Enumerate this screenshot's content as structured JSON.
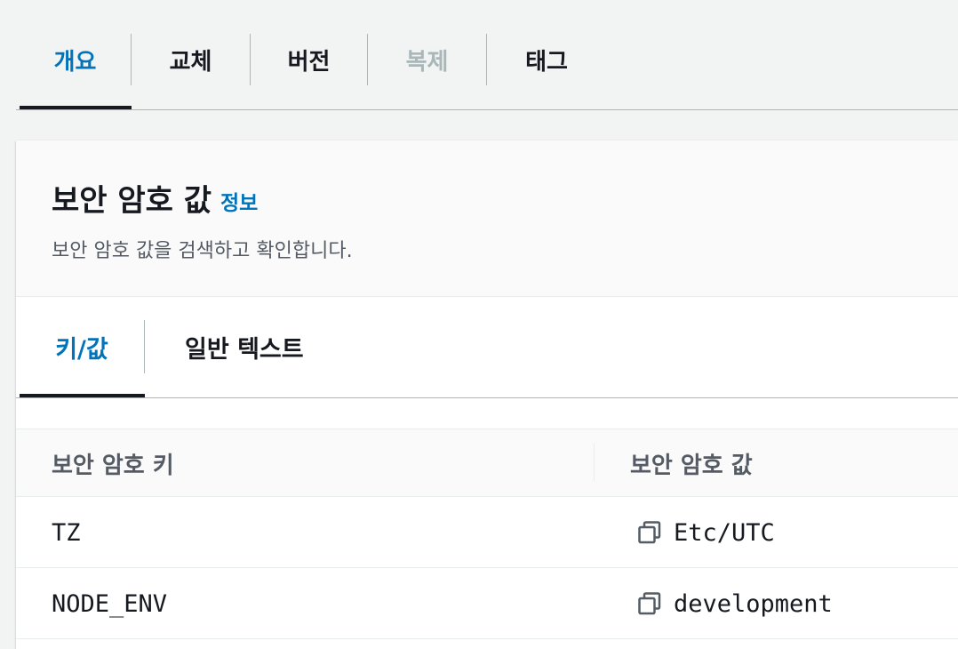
{
  "top_tabs": [
    {
      "label": "개요",
      "state": "active"
    },
    {
      "label": "교체",
      "state": "normal"
    },
    {
      "label": "버전",
      "state": "normal"
    },
    {
      "label": "복제",
      "state": "disabled"
    },
    {
      "label": "태그",
      "state": "normal"
    }
  ],
  "panel": {
    "title": "보안 암호 값",
    "info_link": "정보",
    "description": "보안 암호 값을 검색하고 확인합니다."
  },
  "inner_tabs": [
    {
      "label": "키/값",
      "state": "active"
    },
    {
      "label": "일반 텍스트",
      "state": "normal"
    }
  ],
  "table": {
    "columns": [
      "보안 암호 키",
      "보안 암호 값"
    ],
    "rows": [
      {
        "key": "TZ",
        "value": "Etc/UTC",
        "icon": "copy-icon"
      },
      {
        "key": "NODE_ENV",
        "value": "development",
        "icon": "copy-icon"
      }
    ]
  },
  "colors": {
    "accent": "#0073bb",
    "text": "#16191f",
    "disabled": "#aab7b8",
    "secondary_text": "#545b64"
  }
}
